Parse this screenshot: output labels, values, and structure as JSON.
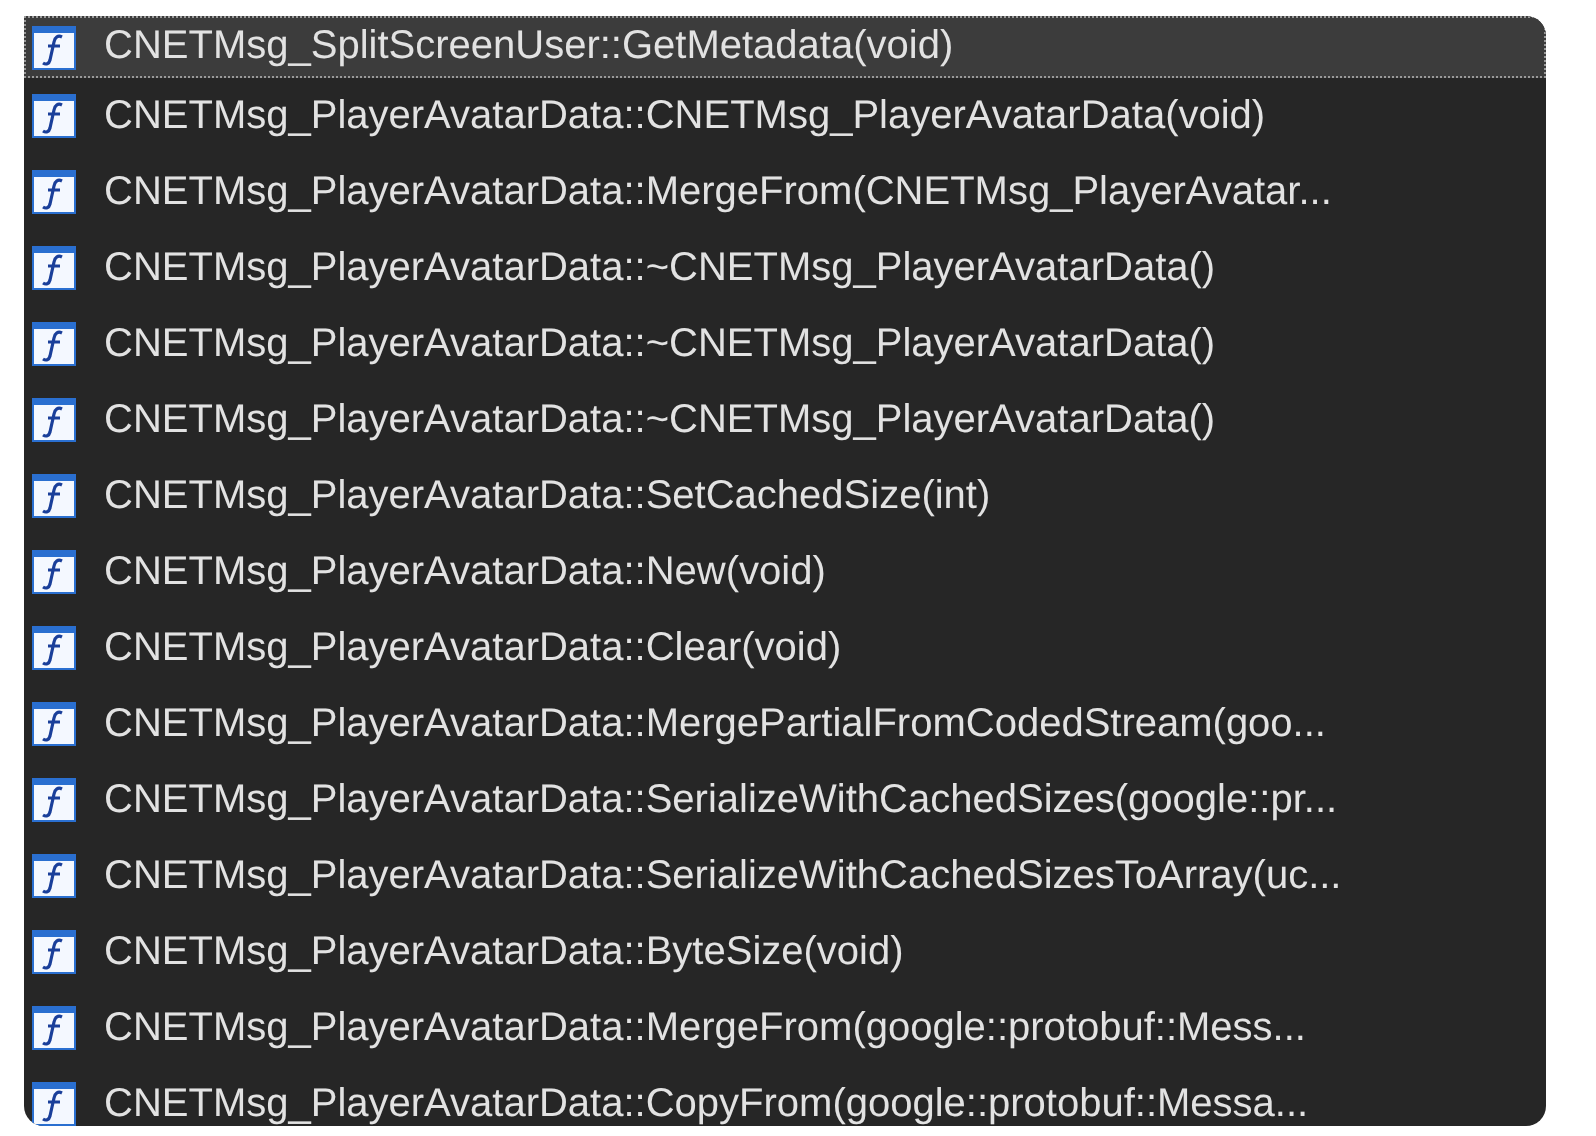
{
  "list": {
    "items": [
      {
        "label": "CNETMsg_SplitScreenUser::GetMetadata(void)",
        "selected": true
      },
      {
        "label": "CNETMsg_PlayerAvatarData::CNETMsg_PlayerAvatarData(void)",
        "selected": false
      },
      {
        "label": "CNETMsg_PlayerAvatarData::MergeFrom(CNETMsg_PlayerAvatar...",
        "selected": false
      },
      {
        "label": "CNETMsg_PlayerAvatarData::~CNETMsg_PlayerAvatarData()",
        "selected": false
      },
      {
        "label": "CNETMsg_PlayerAvatarData::~CNETMsg_PlayerAvatarData()",
        "selected": false
      },
      {
        "label": "CNETMsg_PlayerAvatarData::~CNETMsg_PlayerAvatarData()",
        "selected": false
      },
      {
        "label": "CNETMsg_PlayerAvatarData::SetCachedSize(int)",
        "selected": false
      },
      {
        "label": "CNETMsg_PlayerAvatarData::New(void)",
        "selected": false
      },
      {
        "label": "CNETMsg_PlayerAvatarData::Clear(void)",
        "selected": false
      },
      {
        "label": "CNETMsg_PlayerAvatarData::MergePartialFromCodedStream(goo...",
        "selected": false
      },
      {
        "label": "CNETMsg_PlayerAvatarData::SerializeWithCachedSizes(google::pr...",
        "selected": false
      },
      {
        "label": "CNETMsg_PlayerAvatarData::SerializeWithCachedSizesToArray(uc...",
        "selected": false
      },
      {
        "label": "CNETMsg_PlayerAvatarData::ByteSize(void)",
        "selected": false
      },
      {
        "label": "CNETMsg_PlayerAvatarData::MergeFrom(google::protobuf::Mess...",
        "selected": false
      },
      {
        "label": "CNETMsg_PlayerAvatarData::CopyFrom(google::protobuf::Messa...",
        "selected": false
      }
    ]
  }
}
